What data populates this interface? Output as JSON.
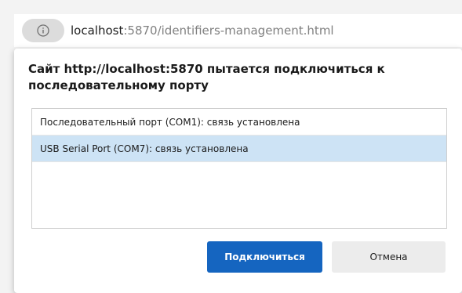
{
  "browser": {
    "url_host": "localhost",
    "url_port": ":5870",
    "url_path": "/identifiers-management.html"
  },
  "dialog": {
    "title": "Сайт http://localhost:5870 пытается подключиться к последовательному порту",
    "ports": [
      "Последовательный порт (COM1): связь установлена",
      "USB Serial Port (COM7): связь установлена"
    ],
    "selected_index": 1,
    "connect_label": "Подключиться",
    "cancel_label": "Отмена"
  },
  "colors": {
    "accent": "#1565c0",
    "selected_row": "#cde3f5"
  },
  "icons": {
    "site_info": "info-icon"
  }
}
